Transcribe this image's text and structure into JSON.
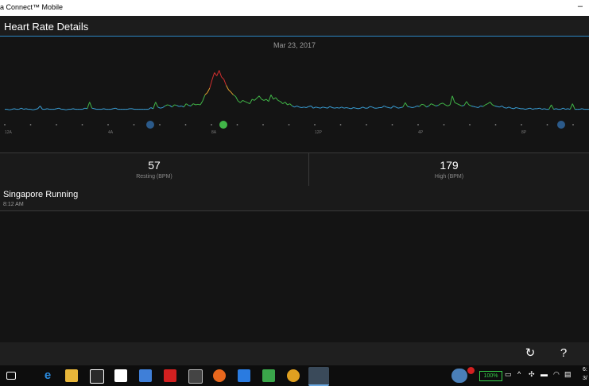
{
  "window": {
    "title": "a Connect™ Mobile",
    "minimize": "–"
  },
  "header": {
    "title": "Heart Rate Details"
  },
  "chart_data": {
    "type": "line",
    "date": "Mar 23, 2017",
    "x_ticks": [
      "12A",
      "4A",
      "8A",
      "12P",
      "4P",
      "8P"
    ],
    "x_range_hours": [
      0,
      24
    ],
    "ylabel": "",
    "y": [
      0.12,
      0.12,
      0.11,
      0.12,
      0.13,
      0.12,
      0.12,
      0.14,
      0.12,
      0.13,
      0.12,
      0.12,
      0.11,
      0.12,
      0.13,
      0.18,
      0.12,
      0.12,
      0.13,
      0.12,
      0.12,
      0.12,
      0.13,
      0.14,
      0.12,
      0.12,
      0.11,
      0.12,
      0.12,
      0.13,
      0.12,
      0.12,
      0.12,
      0.12,
      0.14,
      0.13,
      0.25,
      0.14,
      0.13,
      0.12,
      0.12,
      0.12,
      0.13,
      0.12,
      0.12,
      0.12,
      0.13,
      0.14,
      0.12,
      0.12,
      0.12,
      0.12,
      0.12,
      0.13,
      0.13,
      0.12,
      0.12,
      0.12,
      0.12,
      0.12,
      0.12,
      0.12,
      0.15,
      0.13,
      0.25,
      0.16,
      0.14,
      0.15,
      0.18,
      0.2,
      0.19,
      0.16,
      0.2,
      0.19,
      0.17,
      0.18,
      0.16,
      0.22,
      0.19,
      0.18,
      0.22,
      0.2,
      0.21,
      0.2,
      0.27,
      0.38,
      0.42,
      0.5,
      0.65,
      0.78,
      0.72,
      0.82,
      0.7,
      0.66,
      0.55,
      0.47,
      0.43,
      0.38,
      0.35,
      0.27,
      0.24,
      0.28,
      0.26,
      0.24,
      0.22,
      0.3,
      0.28,
      0.32,
      0.36,
      0.3,
      0.28,
      0.3,
      0.26,
      0.38,
      0.3,
      0.33,
      0.28,
      0.26,
      0.22,
      0.25,
      0.2,
      0.22,
      0.18,
      0.16,
      0.18,
      0.16,
      0.15,
      0.16,
      0.15,
      0.17,
      0.18,
      0.14,
      0.16,
      0.15,
      0.14,
      0.16,
      0.15,
      0.14,
      0.17,
      0.15,
      0.14,
      0.15,
      0.14,
      0.16,
      0.14,
      0.15,
      0.14,
      0.13,
      0.15,
      0.14,
      0.13,
      0.14,
      0.16,
      0.14,
      0.14,
      0.17,
      0.16,
      0.14,
      0.14,
      0.15,
      0.15,
      0.18,
      0.16,
      0.15,
      0.14,
      0.18,
      0.16,
      0.14,
      0.15,
      0.16,
      0.24,
      0.17,
      0.16,
      0.15,
      0.16,
      0.18,
      0.17,
      0.21,
      0.2,
      0.16,
      0.18,
      0.22,
      0.2,
      0.18,
      0.19,
      0.22,
      0.23,
      0.2,
      0.18,
      0.2,
      0.36,
      0.24,
      0.22,
      0.2,
      0.18,
      0.19,
      0.26,
      0.2,
      0.18,
      0.17,
      0.16,
      0.15,
      0.18,
      0.17,
      0.2,
      0.22,
      0.25,
      0.2,
      0.18,
      0.17,
      0.16,
      0.18,
      0.15,
      0.14,
      0.16,
      0.14,
      0.13,
      0.15,
      0.14,
      0.13,
      0.13,
      0.12,
      0.13,
      0.14,
      0.12,
      0.13,
      0.13,
      0.14,
      0.12,
      0.13,
      0.12,
      0.12,
      0.2,
      0.12,
      0.13,
      0.12,
      0.12,
      0.14,
      0.12,
      0.13,
      0.12,
      0.22,
      0.12,
      0.12,
      0.12,
      0.13,
      0.12,
      0.12,
      0.12
    ]
  },
  "stats": {
    "resting": {
      "value": "57",
      "label": "Resting (BPM)"
    },
    "high": {
      "value": "179",
      "label": "High (BPM)"
    }
  },
  "activity": {
    "name": "Singapore Running",
    "time": "8:12 AM"
  },
  "bottom": {
    "refresh": "↻",
    "help": "?"
  },
  "taskbar": {
    "battery": "100%",
    "clock_time": "6:",
    "clock_date": "3/"
  },
  "colors": {
    "line_base": "#3aa0d8",
    "line_mid": "#41b648",
    "line_high": "#d32f2f",
    "accent": "#2b86c3"
  }
}
